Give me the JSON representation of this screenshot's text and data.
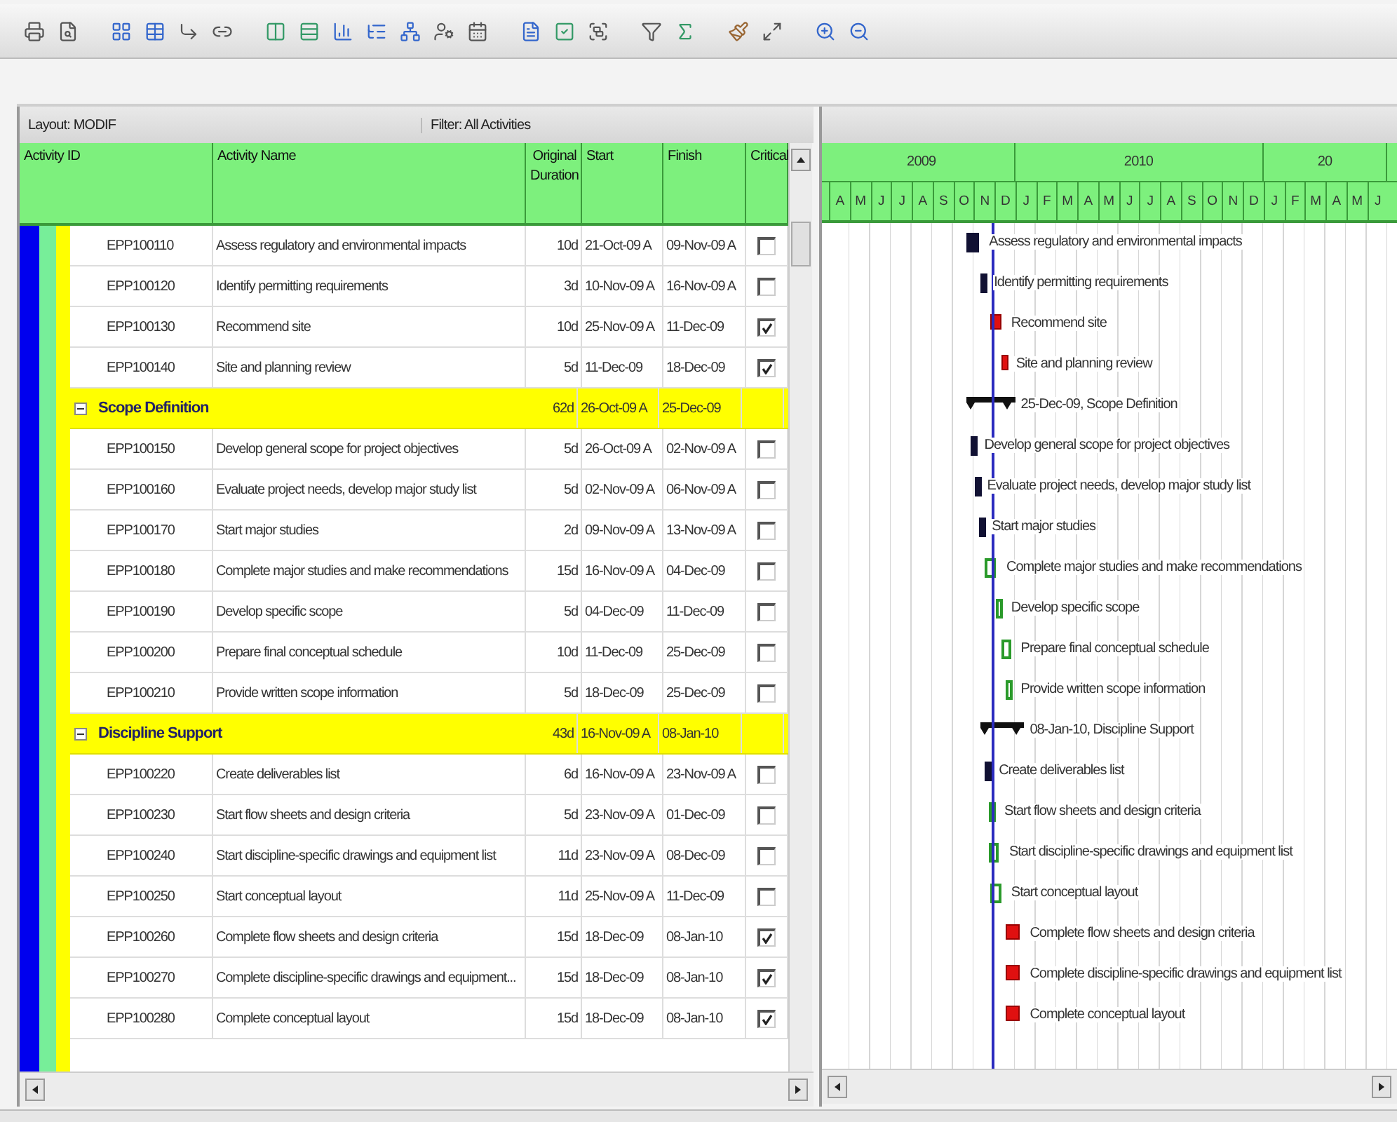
{
  "layout_bar": {
    "layout": "Layout: MODIF",
    "filter": "Filter: All Activities"
  },
  "columns": [
    {
      "label": "Activity ID"
    },
    {
      "label": "Activity Name"
    },
    {
      "label": "Original Duration"
    },
    {
      "label": "Start"
    },
    {
      "label": "Finish"
    },
    {
      "label": "Critical"
    }
  ],
  "timescale": {
    "years": [
      {
        "label": "2009"
      },
      {
        "label": "2010"
      },
      {
        "label": "20"
      }
    ],
    "months": [
      "A",
      "M",
      "J",
      "J",
      "A",
      "S",
      "O",
      "N",
      "D",
      "J",
      "F",
      "M",
      "A",
      "M",
      "J",
      "J",
      "A",
      "S",
      "O",
      "N",
      "D",
      "J",
      "F",
      "M",
      "A",
      "M",
      "J"
    ]
  },
  "rows": [
    {
      "kind": "activity",
      "id": "EPP100110",
      "name": "Assess regulatory and environmental impacts",
      "duration": "10d",
      "start": "21-Oct-09 A",
      "finish": "09-Nov-09 A",
      "critical": false,
      "bar_label": "Assess regulatory and environmental impacts"
    },
    {
      "kind": "activity",
      "id": "EPP100120",
      "name": "Identify permitting requirements",
      "duration": "3d",
      "start": "10-Nov-09 A",
      "finish": "16-Nov-09 A",
      "critical": false,
      "bar_label": "Identify permitting requirements"
    },
    {
      "kind": "activity",
      "id": "EPP100130",
      "name": "Recommend site",
      "duration": "10d",
      "start": "25-Nov-09 A",
      "finish": "11-Dec-09",
      "critical": true,
      "bar_label": "Recommend site"
    },
    {
      "kind": "activity",
      "id": "EPP100140",
      "name": "Site and planning review",
      "duration": "5d",
      "start": "11-Dec-09",
      "finish": "18-Dec-09",
      "critical": true,
      "bar_label": "Site and planning review"
    },
    {
      "kind": "wbs",
      "name": "Scope Definition",
      "expanded": true,
      "duration": "62d",
      "start": "26-Oct-09 A",
      "finish": "25-Dec-09",
      "bar_label": "25-Dec-09, Scope Definition"
    },
    {
      "kind": "activity",
      "id": "EPP100150",
      "name": "Develop general scope for project objectives",
      "duration": "5d",
      "start": "26-Oct-09 A",
      "finish": "02-Nov-09 A",
      "critical": false,
      "bar_label": "Develop general scope for project objectives"
    },
    {
      "kind": "activity",
      "id": "EPP100160",
      "name": "Evaluate project needs, develop major study list",
      "duration": "5d",
      "start": "02-Nov-09 A",
      "finish": "06-Nov-09 A",
      "critical": false,
      "bar_label": "Evaluate project needs, develop major study list"
    },
    {
      "kind": "activity",
      "id": "EPP100170",
      "name": "Start major studies",
      "duration": "2d",
      "start": "09-Nov-09 A",
      "finish": "13-Nov-09 A",
      "critical": false,
      "bar_label": "Start major studies"
    },
    {
      "kind": "activity",
      "id": "EPP100180",
      "name": "Complete major studies and make recommendations",
      "duration": "15d",
      "start": "16-Nov-09 A",
      "finish": "04-Dec-09",
      "critical": false,
      "bar_label": "Complete major studies and make recommendations"
    },
    {
      "kind": "activity",
      "id": "EPP100190",
      "name": "Develop specific scope",
      "duration": "5d",
      "start": "04-Dec-09",
      "finish": "11-Dec-09",
      "critical": false,
      "bar_label": "Develop specific scope"
    },
    {
      "kind": "activity",
      "id": "EPP100200",
      "name": "Prepare final conceptual schedule",
      "duration": "10d",
      "start": "11-Dec-09",
      "finish": "25-Dec-09",
      "critical": false,
      "bar_label": "Prepare final conceptual schedule"
    },
    {
      "kind": "activity",
      "id": "EPP100210",
      "name": "Provide written scope information",
      "duration": "5d",
      "start": "18-Dec-09",
      "finish": "25-Dec-09",
      "critical": false,
      "bar_label": "Provide written scope information"
    },
    {
      "kind": "wbs",
      "name": "Discipline Support",
      "expanded": true,
      "duration": "43d",
      "start": "16-Nov-09 A",
      "finish": "08-Jan-10",
      "bar_label": "08-Jan-10, Discipline Support"
    },
    {
      "kind": "activity",
      "id": "EPP100220",
      "name": "Create deliverables list",
      "duration": "6d",
      "start": "16-Nov-09 A",
      "finish": "23-Nov-09 A",
      "critical": false,
      "bar_label": "Create deliverables list"
    },
    {
      "kind": "activity",
      "id": "EPP100230",
      "name": "Start flow sheets and design criteria",
      "duration": "5d",
      "start": "23-Nov-09 A",
      "finish": "01-Dec-09",
      "critical": false,
      "bar_label": "Start flow sheets and design criteria"
    },
    {
      "kind": "activity",
      "id": "EPP100240",
      "name": "Start discipline-specific drawings and equipment list",
      "duration": "11d",
      "start": "23-Nov-09 A",
      "finish": "08-Dec-09",
      "critical": false,
      "bar_label": "Start discipline-specific drawings and equipment list"
    },
    {
      "kind": "activity",
      "id": "EPP100250",
      "name": "Start conceptual layout",
      "duration": "11d",
      "start": "25-Nov-09 A",
      "finish": "11-Dec-09",
      "critical": false,
      "bar_label": "Start conceptual layout"
    },
    {
      "kind": "activity",
      "id": "EPP100260",
      "name": "Complete flow sheets and design criteria",
      "duration": "15d",
      "start": "18-Dec-09",
      "finish": "08-Jan-10",
      "critical": true,
      "bar_label": "Complete flow sheets and design criteria"
    },
    {
      "kind": "activity",
      "id": "EPP100270",
      "name": "Complete discipline-specific drawings and equipment...",
      "duration": "15d",
      "start": "18-Dec-09",
      "finish": "08-Jan-10",
      "critical": true,
      "bar_label": "Complete discipline-specific drawings and equipment list"
    },
    {
      "kind": "activity",
      "id": "EPP100280",
      "name": "Complete conceptual layout",
      "duration": "15d",
      "start": "18-Dec-09",
      "finish": "08-Jan-10",
      "critical": true,
      "bar_label": "Complete conceptual layout"
    }
  ]
}
